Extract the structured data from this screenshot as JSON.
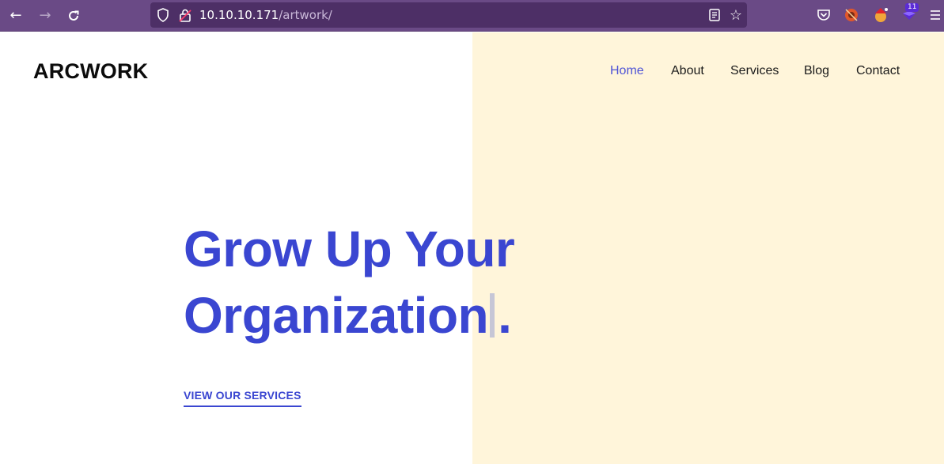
{
  "browser": {
    "url_host": "10.10.10.171",
    "url_path": "/artwork/",
    "extension_badge": "11"
  },
  "site": {
    "brand": "ARCWORK",
    "nav": [
      "Home",
      "About",
      "Services",
      "Blog",
      "Contact"
    ],
    "active_nav": "Home",
    "hero_line1": "Grow Up Your",
    "hero_line2": "Organization",
    "hero_punct": ".",
    "cta": "VIEW OUR SERVICES"
  },
  "colors": {
    "accent": "#3a46d1",
    "cream_panel": "#fff5da",
    "toolbar": "#6a4a86"
  }
}
